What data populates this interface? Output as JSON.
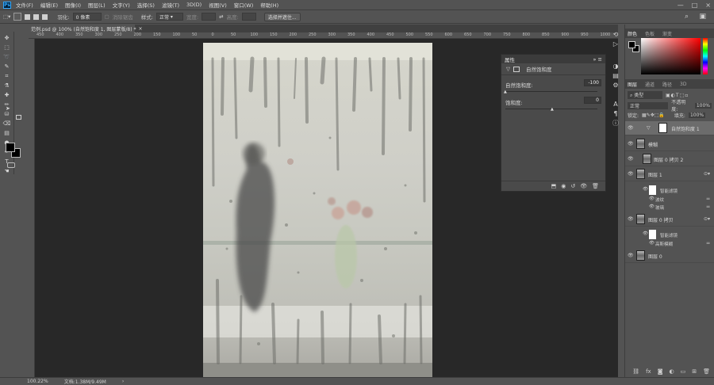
{
  "app": {
    "logo": "Ps",
    "menu": [
      "文件(F)",
      "编辑(E)",
      "图像(I)",
      "图层(L)",
      "文字(Y)",
      "选择(S)",
      "滤镜(T)",
      "3D(D)",
      "视图(V)",
      "窗口(W)",
      "帮助(H)"
    ]
  },
  "options": {
    "feather_label": "羽化:",
    "feather_value": "0 像素",
    "antialias_label": "消除锯齿",
    "style_label": "样式:",
    "style_value": "正常",
    "width_label": "宽度:",
    "height_label": "高度:",
    "select_mask_btn": "选择并遮住..."
  },
  "document": {
    "tab_title": "范例.psd @ 100% (自然饱和度 1, 图层蒙版/8) *",
    "tab_close": "×",
    "ruler_marks": [
      "450",
      "400",
      "350",
      "300",
      "250",
      "200",
      "150",
      "100",
      "50",
      "0",
      "50",
      "100",
      "150",
      "200",
      "250",
      "300",
      "350",
      "400",
      "450",
      "500",
      "550",
      "600",
      "650",
      "700",
      "750",
      "800",
      "850",
      "900",
      "950",
      "1000",
      "1050"
    ]
  },
  "status": {
    "zoom": "100.22%",
    "doc_size": "文档:1.38M/9.49M"
  },
  "properties": {
    "title": "属性",
    "adjustment_name": "自然饱和度",
    "vibrance_label": "自然饱和度:",
    "vibrance_value": "-100",
    "vibrance_pct": 0,
    "saturation_label": "饱和度:",
    "saturation_value": "0",
    "saturation_pct": 50
  },
  "color_panel": {
    "tabs": [
      "颜色",
      "色板",
      "渐变"
    ],
    "active_tab": "颜色"
  },
  "layers_panel": {
    "tabs": [
      "图层",
      "通道",
      "路径",
      "3D"
    ],
    "active_tab": "图层",
    "filter_label": "类型",
    "blend_mode": "正常",
    "opacity_label": "不透明度:",
    "opacity_value": "100%",
    "lock_label": "锁定:",
    "fill_label": "填充:",
    "fill_value": "100%",
    "layers": [
      {
        "name": "自然饱和度 1",
        "selected": true
      },
      {
        "name": "模糊"
      },
      {
        "name": "图层 0 拷贝 2"
      },
      {
        "name": "图层 1",
        "smart_filter": "智能滤镜",
        "filters": [
          "波纹",
          "玻璃"
        ]
      },
      {
        "name": "图层 0 拷贝",
        "smart_filter": "智能滤镜",
        "filters": [
          "高斯模糊"
        ]
      },
      {
        "name": "图层 0"
      }
    ]
  },
  "colors": {
    "accent": "#31a8ff",
    "panel_bg": "#535353",
    "canvas_bg": "#282828"
  }
}
